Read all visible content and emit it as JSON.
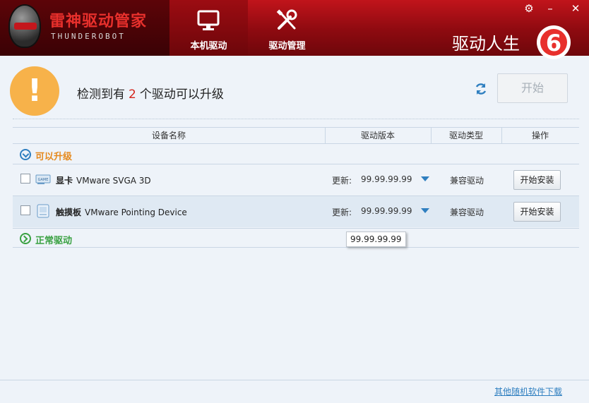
{
  "app": {
    "title": "雷神驱动管家",
    "subtitle": "THUNDEROBOT"
  },
  "nav": {
    "tabs": [
      {
        "label": "本机驱动",
        "icon": "monitor-icon",
        "active": true
      },
      {
        "label": "驱动管理",
        "icon": "tools-icon",
        "active": false
      }
    ]
  },
  "header": {
    "slogan": "驱动人生",
    "badge": "6",
    "settings_icon": "gear-icon",
    "close_icon": "close-icon"
  },
  "status": {
    "prefix": "检测到有",
    "count": "2",
    "suffix": "个驱动可以升级",
    "start_label": "开始"
  },
  "table": {
    "columns": [
      "设备名称",
      "驱动版本",
      "驱动类型",
      "操作"
    ],
    "groups": {
      "upgradable_label": "可以升级",
      "normal_label": "正常驱动"
    },
    "rows": [
      {
        "category": "显卡",
        "name": "VMware SVGA 3D",
        "update_label": "更新:",
        "version": "99.99.99.99",
        "type": "兼容驱动",
        "action": "开始安装",
        "icon": "graphics-card-icon"
      },
      {
        "category": "触摸板",
        "name": "VMware Pointing Device",
        "update_label": "更新:",
        "version": "99.99.99.99",
        "type": "兼容驱动",
        "action": "开始安装",
        "icon": "touchpad-icon"
      }
    ]
  },
  "tooltip": {
    "text": "99.99.99.99"
  },
  "footer": {
    "link": "其他随机软件下载"
  },
  "colors": {
    "header_red": "#a80f16",
    "accent_orange": "#f7b24a",
    "count_red": "#d4251d",
    "link_blue": "#2f7fc0",
    "group_upgrade": "#e58a1f",
    "group_normal": "#3aa142"
  }
}
